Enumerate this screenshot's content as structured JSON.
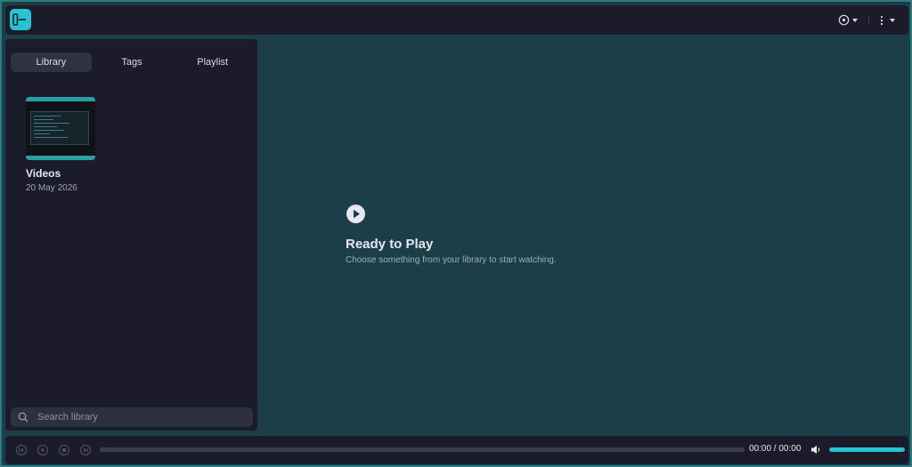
{
  "app": {
    "brand_color": "#27c3d3",
    "logo_icon": "app-logo-icon"
  },
  "titlebar": {
    "icons": [
      "target-menu-icon",
      "kebab-menu-icon"
    ]
  },
  "sidebar": {
    "tabs": [
      {
        "label": "Library",
        "active": true
      },
      {
        "label": "Tags",
        "active": false
      },
      {
        "label": "Playlist",
        "active": false
      }
    ],
    "items": [
      {
        "title": "Videos",
        "date": "20 May 2026"
      }
    ],
    "search": {
      "placeholder": "Search library"
    }
  },
  "player": {
    "empty_title": "Ready to Play",
    "empty_subtitle": "Choose something from your library to start watching.",
    "time": "00:00 / 00:00",
    "progress": 0,
    "volume": 1.0
  }
}
